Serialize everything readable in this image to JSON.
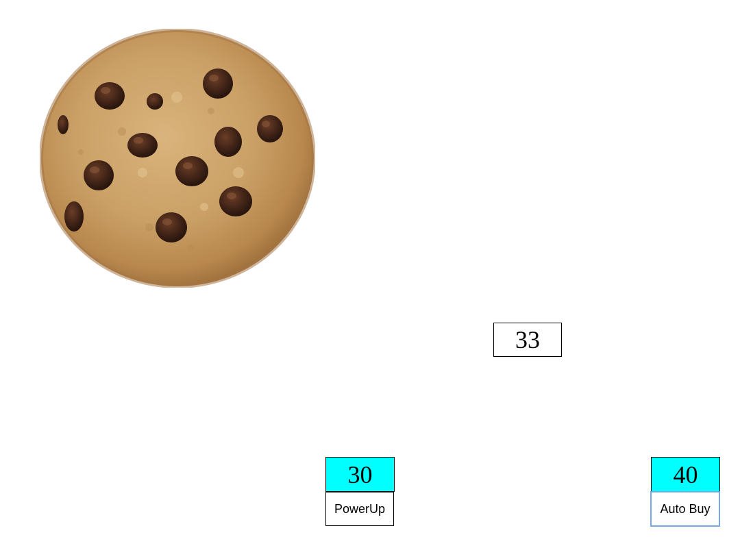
{
  "score": {
    "value": "33"
  },
  "upgrades": [
    {
      "cost": "30",
      "label": "PowerUp"
    },
    {
      "cost": "40",
      "label": "Auto Buy"
    }
  ],
  "colors": {
    "cost_background": "#00ffff",
    "button_background": "#ffffff",
    "focus_ring": "#7aa7e6"
  },
  "icons": {
    "cookie": "cookie-icon"
  }
}
